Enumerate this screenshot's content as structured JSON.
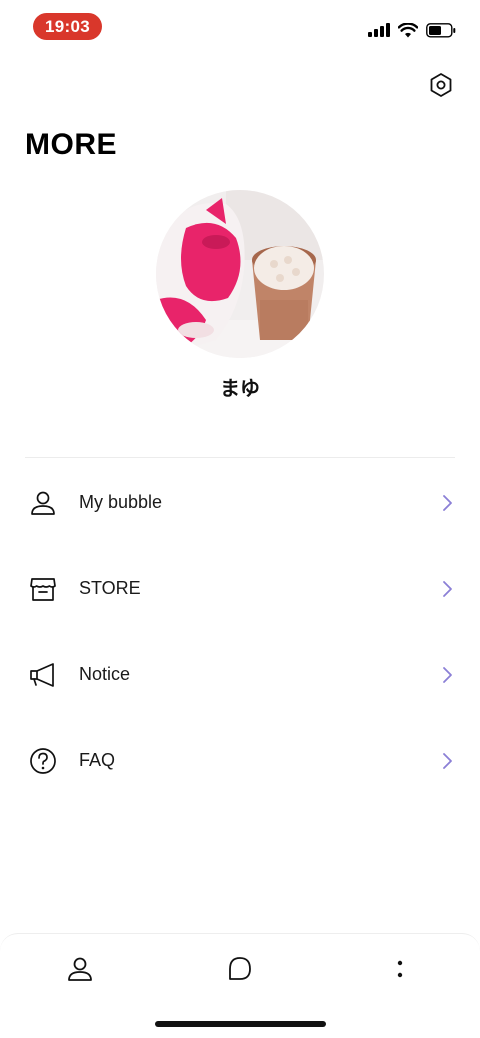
{
  "status_bar": {
    "time": "19:03"
  },
  "header": {
    "title": "MORE"
  },
  "profile": {
    "name": "まゆ"
  },
  "menu": [
    {
      "label": "My bubble",
      "icon": "person-icon"
    },
    {
      "label": "STORE",
      "icon": "store-icon"
    },
    {
      "label": "Notice",
      "icon": "megaphone-icon"
    },
    {
      "label": "FAQ",
      "icon": "question-icon"
    }
  ],
  "bottom_nav": [
    {
      "icon": "person-icon"
    },
    {
      "icon": "chat-bubble-icon"
    },
    {
      "icon": "more-vertical-icon"
    }
  ],
  "colors": {
    "accent": "#8b7fd6",
    "time_pill": "#d9372b",
    "text": "#111111",
    "divider": "#ececec"
  }
}
